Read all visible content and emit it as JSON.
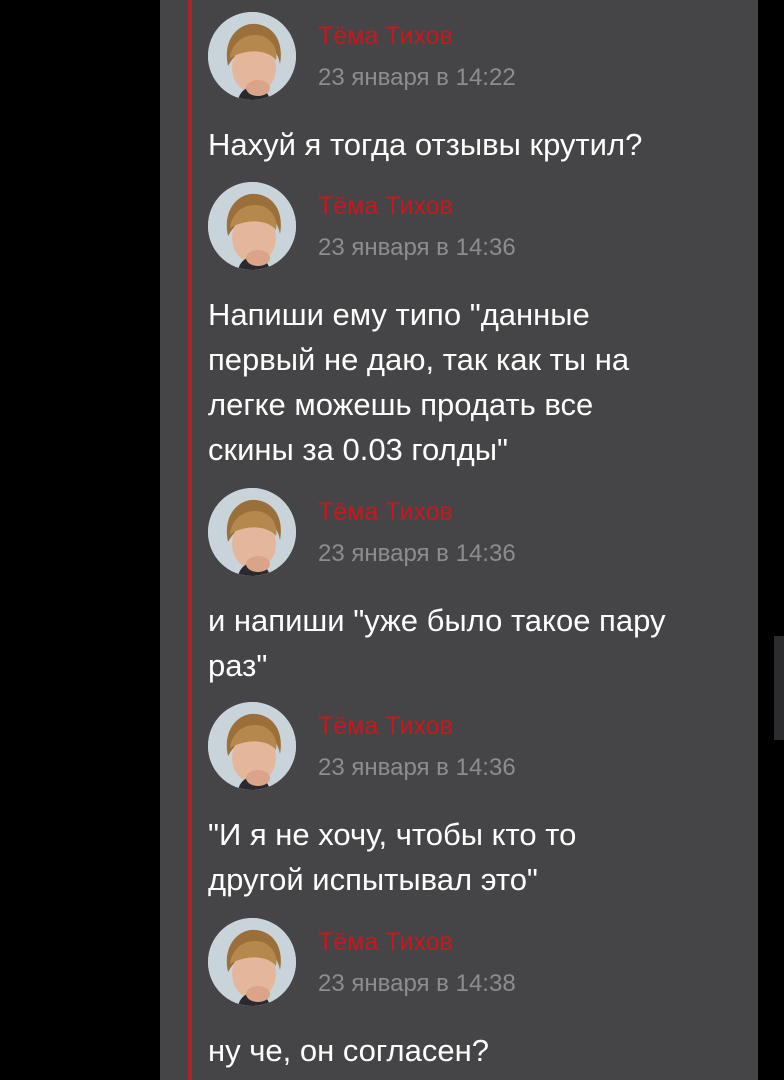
{
  "colors": {
    "background": "#000000",
    "panel": "#454547",
    "accent": "#a8262a",
    "author": "#c8181c",
    "timestamp": "#8d8d90",
    "text": "#ffffff"
  },
  "messages": [
    {
      "author": "Тёма Тихов",
      "time": "23 января в 14:22",
      "text": "Нахуй я тогда отзывы крутил?",
      "avatar_icon": "user-avatar-icon"
    },
    {
      "author": "Тёма Тихов",
      "time": "23 января в 14:36",
      "text": "Напиши ему типо \"данные\nпервый не даю, так как ты на\nлегке можешь продать все\nскины за 0.03 голды\"",
      "avatar_icon": "user-avatar-icon"
    },
    {
      "author": "Тёма Тихов",
      "time": "23 января в 14:36",
      "text": "и напиши \"уже было такое пару\nраз\"",
      "avatar_icon": "user-avatar-icon"
    },
    {
      "author": "Тёма Тихов",
      "time": "23 января в 14:36",
      "text": "\"И я не хочу, чтобы кто то\nдругой испытывал это\"",
      "avatar_icon": "user-avatar-icon"
    },
    {
      "author": "Тёма Тихов",
      "time": "23 января в 14:38",
      "text": "ну че, он согласен?",
      "avatar_icon": "user-avatar-icon"
    }
  ]
}
